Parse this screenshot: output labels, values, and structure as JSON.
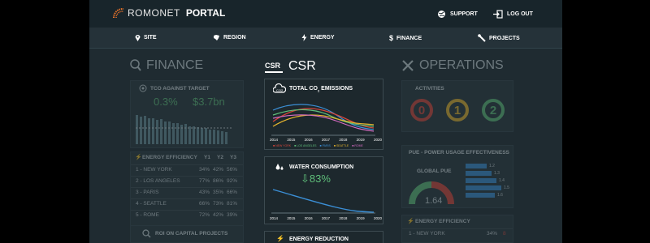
{
  "brand": {
    "name": "ROMONET",
    "product": "PORTAL"
  },
  "top_links": [
    {
      "label": "SUPPORT",
      "icon": "globe-icon"
    },
    {
      "label": "LOG OUT",
      "icon": "logout-icon"
    }
  ],
  "nav": [
    {
      "label": "SITE",
      "icon": "location-pin-icon"
    },
    {
      "label": "REGION",
      "icon": "region-icon"
    },
    {
      "label": "ENERGY",
      "icon": "lightning-icon"
    },
    {
      "label": "FINANCE",
      "icon": "dollar-icon"
    },
    {
      "label": "PROJECTS",
      "icon": "wrench-icon"
    }
  ],
  "finance": {
    "title": "FINANCE",
    "tco": {
      "label": "TCO AGAINST TARGET",
      "pct": "0.3%",
      "value": "$3.7bn"
    },
    "energy_efficiency": {
      "label": "ENERGY EFFICIENCY",
      "cols": [
        "Y1",
        "Y2",
        "Y3"
      ],
      "rows": [
        {
          "name": "1 - NEW YORK",
          "v": [
            "34%",
            "42%",
            "56%"
          ]
        },
        {
          "name": "2 - LOS ANGELES",
          "v": [
            "77%",
            "86%",
            "92%"
          ]
        },
        {
          "name": "3 - PARIS",
          "v": [
            "43%",
            "35%",
            "66%"
          ]
        },
        {
          "name": "4 - SEATTLE",
          "v": [
            "66%",
            "73%",
            "81%"
          ]
        },
        {
          "name": "5 - ROME",
          "v": [
            "72%",
            "42%",
            "39%"
          ]
        }
      ]
    },
    "roi_label": "ROI ON CAPITAL PROJECTS"
  },
  "csr": {
    "title": "CSR",
    "co2": {
      "label_pre": "TOTAL CO",
      "label_sub": "2",
      "label_post": " EMISSIONS",
      "years": [
        "2014",
        "2015",
        "2016",
        "2017",
        "2018",
        "2019",
        "2020"
      ],
      "legend": [
        "NEW YORK",
        "LOS ANGELES",
        "PARIS",
        "SEATTLE",
        "ROME"
      ]
    },
    "water": {
      "label": "WATER CONSUMPTION",
      "value": "83%",
      "years": [
        "2014",
        "2015",
        "2016",
        "2017",
        "2018",
        "2019",
        "2020"
      ]
    },
    "energy_reduction": {
      "label": "ENERGY REDUCTION"
    }
  },
  "operations": {
    "title": "OPERATIONS",
    "activities": {
      "label": "ACTIVITIES",
      "counts": [
        "0",
        "1",
        "2"
      ]
    },
    "pue": {
      "label": "PUE - POWER USAGE EFFECTIVENESS",
      "global_label": "GLOBAL PUE",
      "global_value": "1.64",
      "bars": [
        "1.2",
        "1.3",
        "1.4",
        "1.5",
        "1.6"
      ]
    },
    "energy_efficiency": {
      "label": "ENERGY EFFICIENCY",
      "row": {
        "name": "1 - NEW YORK",
        "v": "34%",
        "n": "8"
      }
    }
  },
  "colors": {
    "accent_orange": "#e8732a",
    "green": "#5fbf7a",
    "red": "#d9473b",
    "yellow": "#e6b52e",
    "blue": "#3b8fd6"
  }
}
